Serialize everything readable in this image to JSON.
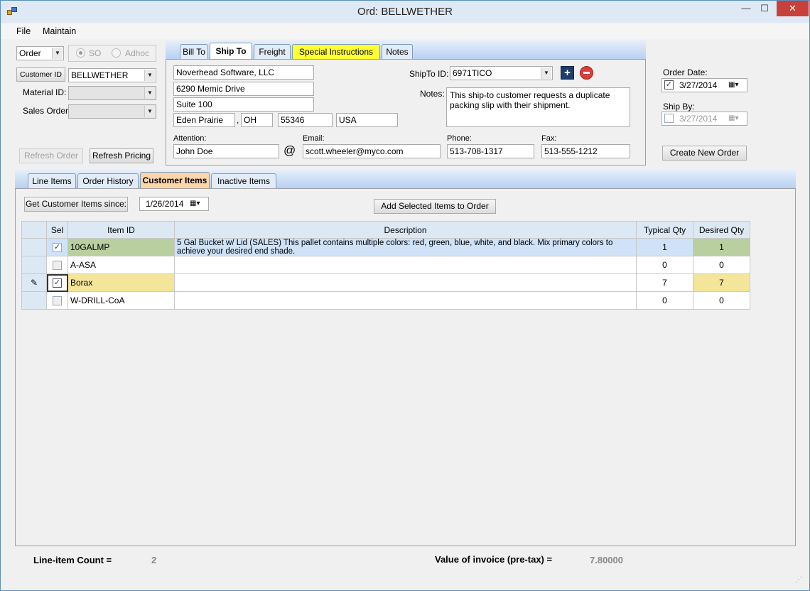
{
  "window": {
    "title": "Ord: BELLWETHER",
    "min": "—",
    "max": "☐",
    "close": "✕"
  },
  "menu": [
    "File",
    "Maintain"
  ],
  "order_type": {
    "value": "Order",
    "so_label": "SO",
    "adhoc_label": "Adhoc"
  },
  "customer": {
    "button_label": "Customer ID",
    "value": "BELLWETHER"
  },
  "material": {
    "label": "Material ID:",
    "value": ""
  },
  "sales_order": {
    "label": "Sales Order:",
    "value": ""
  },
  "buttons": {
    "refresh_order": "Refresh Order",
    "refresh_pricing": "Refresh Pricing",
    "create_new_order": "Create New Order",
    "get_customer_items": "Get Customer Items since:",
    "add_selected": "Add Selected Items to Order"
  },
  "ship_tabs": [
    "Bill To",
    "Ship To",
    "Freight",
    "Special Instructions",
    "Notes"
  ],
  "ship_to": {
    "name": "Noverhead Software, LLC",
    "address1": "6290 Memic Drive",
    "address2": "Suite 100",
    "city": "Eden Prairie",
    "state": "OH",
    "zip": "55346",
    "country": "USA",
    "shipto_label": "ShipTo ID:",
    "shipto_id": "6971TICO",
    "notes_label": "Notes:",
    "notes": "This ship-to customer requests a duplicate packing slip with their shipment.",
    "attention_label": "Attention:",
    "attention": "John Doe",
    "email_label": "Email:",
    "email": "scott.wheeler@myco.com",
    "phone_label": "Phone:",
    "phone": "513-708-1317",
    "fax_label": "Fax:",
    "fax": "513-555-1212",
    "at_symbol": "@",
    "comma": ","
  },
  "dates": {
    "order_label": "Order Date:",
    "order_value": "3/27/2014",
    "shipby_label": "Ship By:",
    "shipby_value": "3/27/2014"
  },
  "item_tabs": [
    "Line Items",
    "Order History",
    "Customer Items",
    "Inactive Items"
  ],
  "since_date": "1/26/2014",
  "grid": {
    "headers": [
      "Sel",
      "Item ID",
      "Description",
      "Typical Qty",
      "Desired Qty"
    ],
    "rows": [
      {
        "sel": true,
        "item": "10GALMP",
        "desc": "5 Gal Bucket w/ Lid (SALES) This pallet contains multiple colors:  red, green, blue, white, and black. Mix primary colors to achieve your desired end shade.",
        "typical": "1",
        "desired": "1"
      },
      {
        "sel": false,
        "item": "A-ASA",
        "desc": "",
        "typical": "0",
        "desired": "0"
      },
      {
        "sel": true,
        "item": "Borax",
        "desc": "",
        "typical": "7",
        "desired": "7"
      },
      {
        "sel": false,
        "item": "W-DRILL-CoA",
        "desc": "",
        "typical": "0",
        "desired": "0"
      }
    ]
  },
  "footer": {
    "count_label": "Line-item Count =",
    "count_value": "2",
    "invoice_label": "Value of invoice (pre-tax) =",
    "invoice_value": "7.80000"
  }
}
